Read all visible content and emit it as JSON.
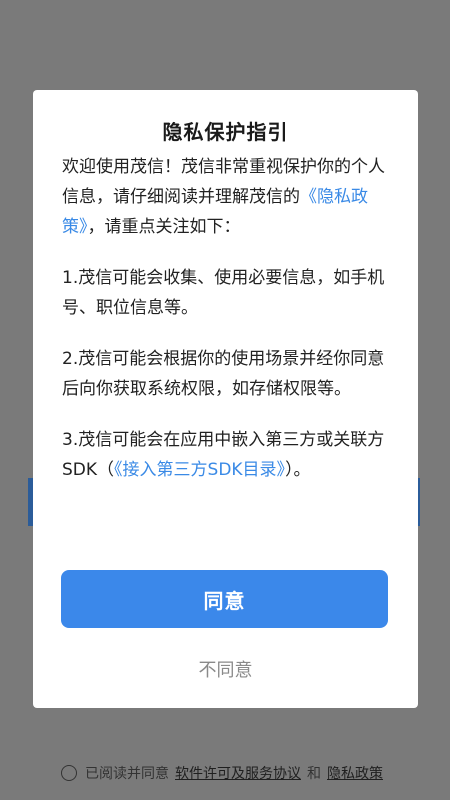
{
  "dialog": {
    "title": "隐私保护指引",
    "intro_text": "欢迎使用茂信！茂信非常重视保护你的个人信息，请仔细阅读并理解茂信的",
    "privacy_link": "《隐私政策》",
    "intro_tail": "，请重点关注如下：",
    "point1": "1.茂信可能会收集、使用必要信息，如手机号、职位信息等。",
    "point2": "2.茂信可能会根据你的使用场景并经你同意后向你获取系统权限，如存储权限等。",
    "point3_text": "3.茂信可能会在应用中嵌入第三方或关联方SDK（",
    "sdk_link": "《接入第三方SDK目录》",
    "point3_tail": "）。",
    "agree_label": "同意",
    "disagree_label": "不同意"
  },
  "footer": {
    "read_agree": "已阅读并同意",
    "license_link": "软件许可及服务协议",
    "and": "和",
    "privacy_link": "隐私政策"
  }
}
